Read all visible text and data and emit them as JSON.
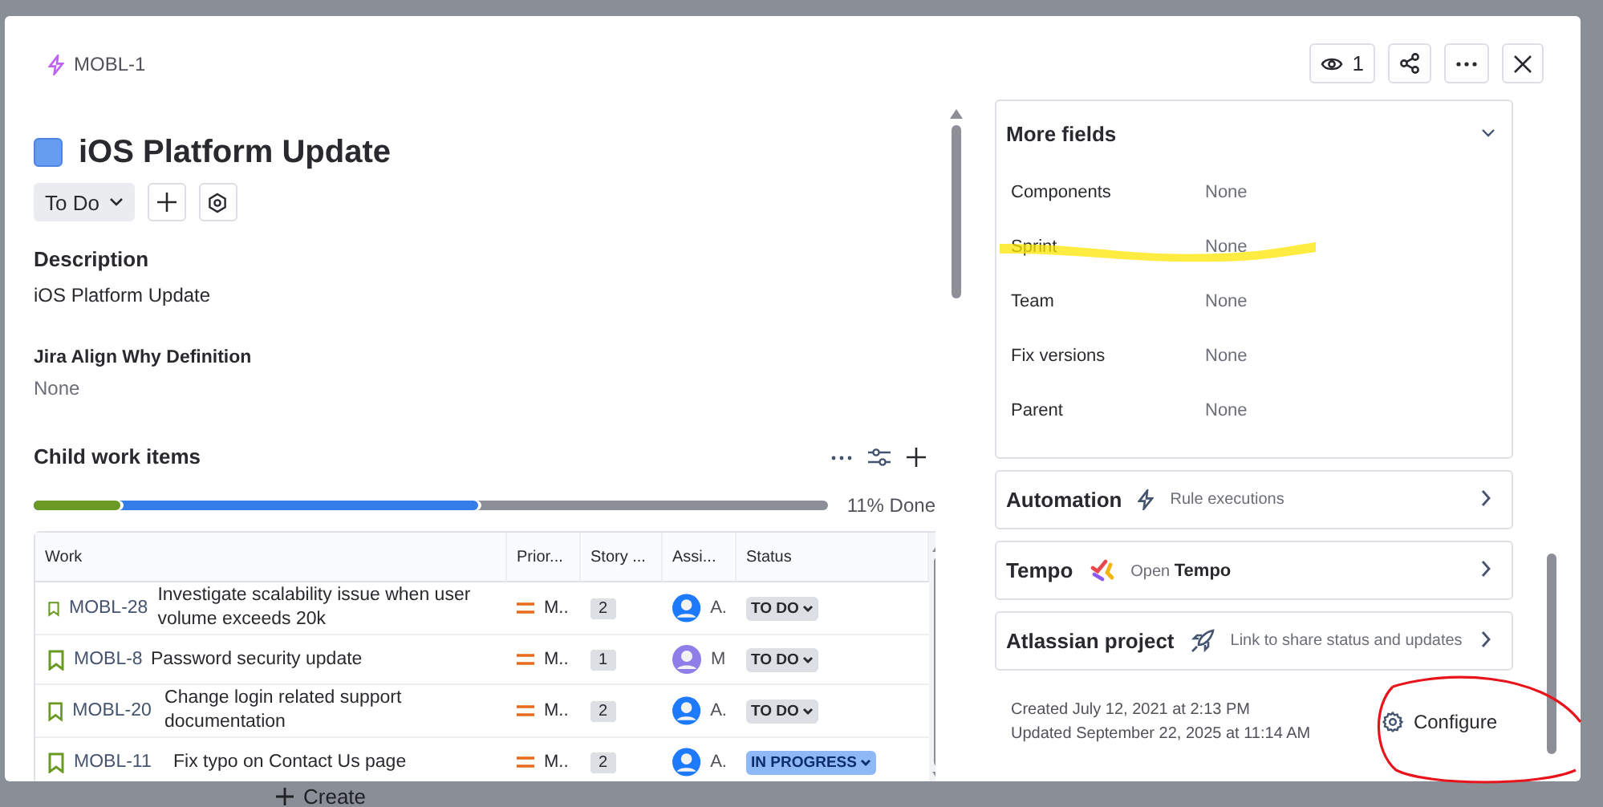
{
  "background": {
    "create_button": "Create"
  },
  "header": {
    "key": "MOBL-1",
    "watchers": "1"
  },
  "issue": {
    "title": "iOS Platform Update",
    "status_button": "To Do"
  },
  "description": {
    "label": "Description",
    "text": "iOS Platform Update"
  },
  "custom_field": {
    "label": "Jira Align Why Definition",
    "value": "None"
  },
  "child_items": {
    "title": "Child work items",
    "progress": [
      {
        "kind": "done",
        "level": 0.11
      },
      {
        "kind": "inprogress",
        "level": 0.56
      }
    ],
    "done_label": "11% Done",
    "columns": [
      "Work",
      "Prior...",
      "Story ...",
      "Assi...",
      "Status"
    ],
    "rows": [
      {
        "key": "MOBL-28",
        "summary": "Investigate scalability issue when user volume exceeds 20k",
        "priority": "M..",
        "points": "2",
        "assignee": "A.",
        "color": "#1d7afc",
        "status": {
          "label": "TO DO",
          "kind": "todo"
        }
      },
      {
        "key": "MOBL-8",
        "summary": "Password security update",
        "priority": "M..",
        "points": "1",
        "assignee": "M",
        "color": "#8f7ee7",
        "status": {
          "label": "TO DO",
          "kind": "todo"
        }
      },
      {
        "key": "MOBL-20",
        "summary": "Change login related support documentation",
        "priority": "M..",
        "points": "2",
        "assignee": "A.",
        "color": "#1d7afc",
        "status": {
          "label": "TO DO",
          "kind": "todo"
        }
      },
      {
        "key": "MOBL-11",
        "summary": "Fix typo on Contact Us page",
        "priority": "M..",
        "points": "2",
        "assignee": "A.",
        "color": "#1d7afc",
        "status": {
          "label": "IN PROGRESS",
          "kind": "inprogress"
        }
      }
    ]
  },
  "more_fields": {
    "title": "More fields",
    "fields": [
      {
        "label": "Components",
        "value": "None"
      },
      {
        "label": "Sprint",
        "value": "None"
      },
      {
        "label": "Team",
        "value": "None"
      },
      {
        "label": "Fix versions",
        "value": "None"
      },
      {
        "label": "Parent",
        "value": "None"
      }
    ]
  },
  "panels": [
    {
      "kind": "automation",
      "title": "Automation",
      "subtitle": "Rule executions"
    },
    {
      "kind": "tempo",
      "title": "Tempo",
      "subtitle": "Open **Tempo**"
    },
    {
      "kind": "project",
      "title": "Atlassian project",
      "subtitle": "Link to share status and updates"
    }
  ],
  "footer": {
    "created": "Created July 12, 2021 at 2:13 PM",
    "updated": "Updated September 22, 2025 at 11:14 AM",
    "configure": "Configure"
  }
}
